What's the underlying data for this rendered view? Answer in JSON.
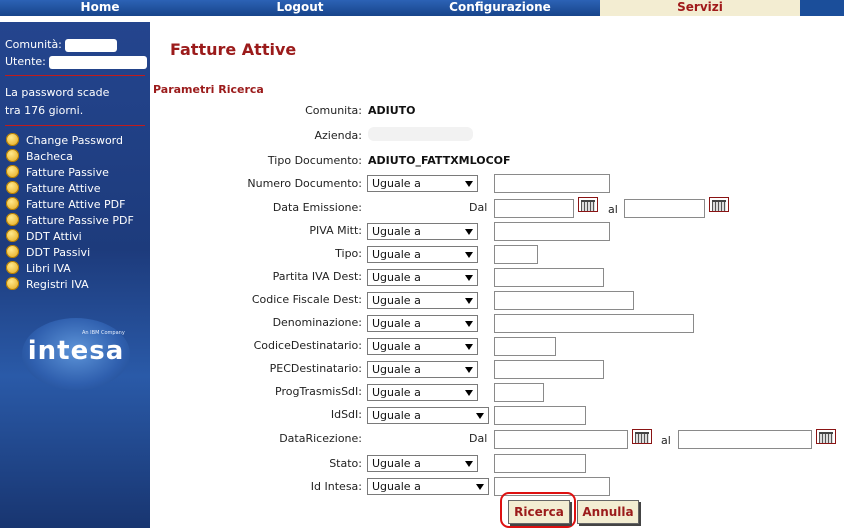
{
  "nav": {
    "tabs": [
      {
        "label": "Home"
      },
      {
        "label": "Logout"
      },
      {
        "label": "Configurazione"
      },
      {
        "label": "Servizi"
      }
    ]
  },
  "sidebar": {
    "community_label": "Comunità:",
    "user_label": "Utente:",
    "password_line1": "La password scade",
    "password_line2": "tra 176 giorni.",
    "menu": [
      {
        "label": "Change Password"
      },
      {
        "label": "Bacheca"
      },
      {
        "label": "Fatture Passive"
      },
      {
        "label": "Fatture Attive"
      },
      {
        "label": "Fatture Attive PDF"
      },
      {
        "label": "Fatture Passive PDF"
      },
      {
        "label": "DDT Attivi"
      },
      {
        "label": "DDT Passivi"
      },
      {
        "label": "Libri IVA"
      },
      {
        "label": "Registri IVA"
      }
    ],
    "logo_text": "intesa",
    "logo_small": "An IBM Company"
  },
  "page": {
    "title": "Fatture Attive",
    "section_title": "Parametri Ricerca"
  },
  "form": {
    "comunita_label": "Comunita:",
    "comunita_value": "ADIUTO",
    "azienda_label": "Azienda:",
    "tipo_doc_label": "Tipo Documento:",
    "tipo_doc_value": "ADIUTO_FATTXMLOCOF",
    "numero_doc_label": "Numero Documento:",
    "data_emissione_label": "Data Emissione:",
    "piva_mitt_label": "PIVA Mitt:",
    "tipo_label": "Tipo:",
    "partita_iva_dest_label": "Partita IVA Dest:",
    "codice_fiscale_dest_label": "Codice Fiscale Dest:",
    "denominazione_label": "Denominazione:",
    "codice_destinatario_label": "CodiceDestinatario:",
    "pec_destinatario_label": "PECDestinatario:",
    "prog_trasmis_label": "ProgTrasmisSdI:",
    "idsdi_label": "IdSdI:",
    "data_ricezione_label": "DataRicezione:",
    "stato_label": "Stato:",
    "id_intesa_label": "Id Intesa:",
    "operator_value": "Uguale a",
    "dal_label": "Dal",
    "al_label": "al"
  },
  "buttons": {
    "ricerca": "Ricerca",
    "annulla": "Annulla"
  }
}
